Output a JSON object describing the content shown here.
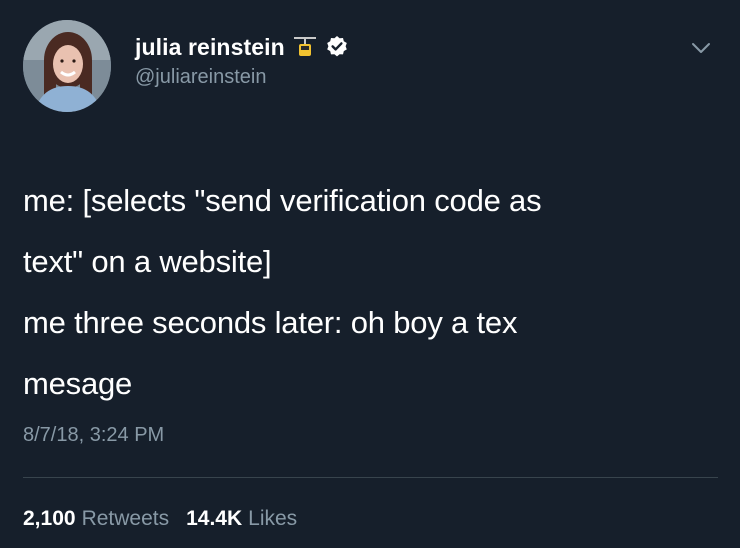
{
  "tweet": {
    "author": {
      "display_name": "julia reinstein",
      "handle": "@juliareinstein",
      "badges": [
        "cable-car-icon",
        "verified-icon"
      ]
    },
    "text_lines": [
      "me: [selects \"send verification code as",
      "text\" on a website]",
      "me three seconds later: oh boy a tex",
      "mesage"
    ],
    "timestamp": "8/7/18, 3:24 PM",
    "stats": {
      "retweets_count": "2,100",
      "retweets_label": "Retweets",
      "likes_count": "14.4K",
      "likes_label": "Likes"
    }
  },
  "colors": {
    "background": "#161f2b",
    "primary_text": "#ffffff",
    "secondary_text": "#8899a6",
    "divider": "#38444d"
  }
}
